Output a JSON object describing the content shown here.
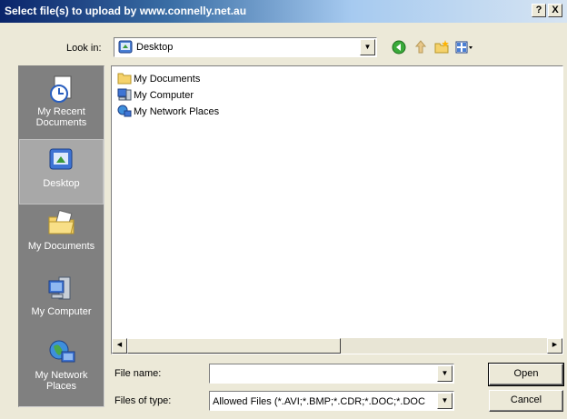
{
  "title": "Select file(s) to upload by www.connelly.net.au",
  "title_buttons": {
    "help": "?",
    "close": "X"
  },
  "look_in": {
    "label": "Look in:",
    "value": "Desktop"
  },
  "toolbar": [
    {
      "icon": "back-arrow-icon"
    },
    {
      "icon": "up-folder-icon"
    },
    {
      "icon": "new-folder-icon"
    },
    {
      "icon": "view-menu-icon"
    }
  ],
  "places": [
    {
      "label": "My Recent Documents",
      "icon": "recent-documents-icon"
    },
    {
      "label": "Desktop",
      "icon": "desktop-icon",
      "active": true
    },
    {
      "label": "My Documents",
      "icon": "my-documents-icon"
    },
    {
      "label": "My Computer",
      "icon": "my-computer-icon"
    },
    {
      "label": "My Network Places",
      "icon": "network-places-icon"
    }
  ],
  "files": [
    {
      "name": "My Documents",
      "icon": "folder-icon"
    },
    {
      "name": "My Computer",
      "icon": "computer-icon"
    },
    {
      "name": "My Network Places",
      "icon": "network-icon"
    }
  ],
  "file_name": {
    "label": "File name:",
    "value": ""
  },
  "file_type": {
    "label": "Files of type:",
    "value": "Allowed Files (*.AVI;*.BMP;*.CDR;*.DOC;*.DOC"
  },
  "buttons": {
    "open": "Open",
    "cancel": "Cancel"
  }
}
